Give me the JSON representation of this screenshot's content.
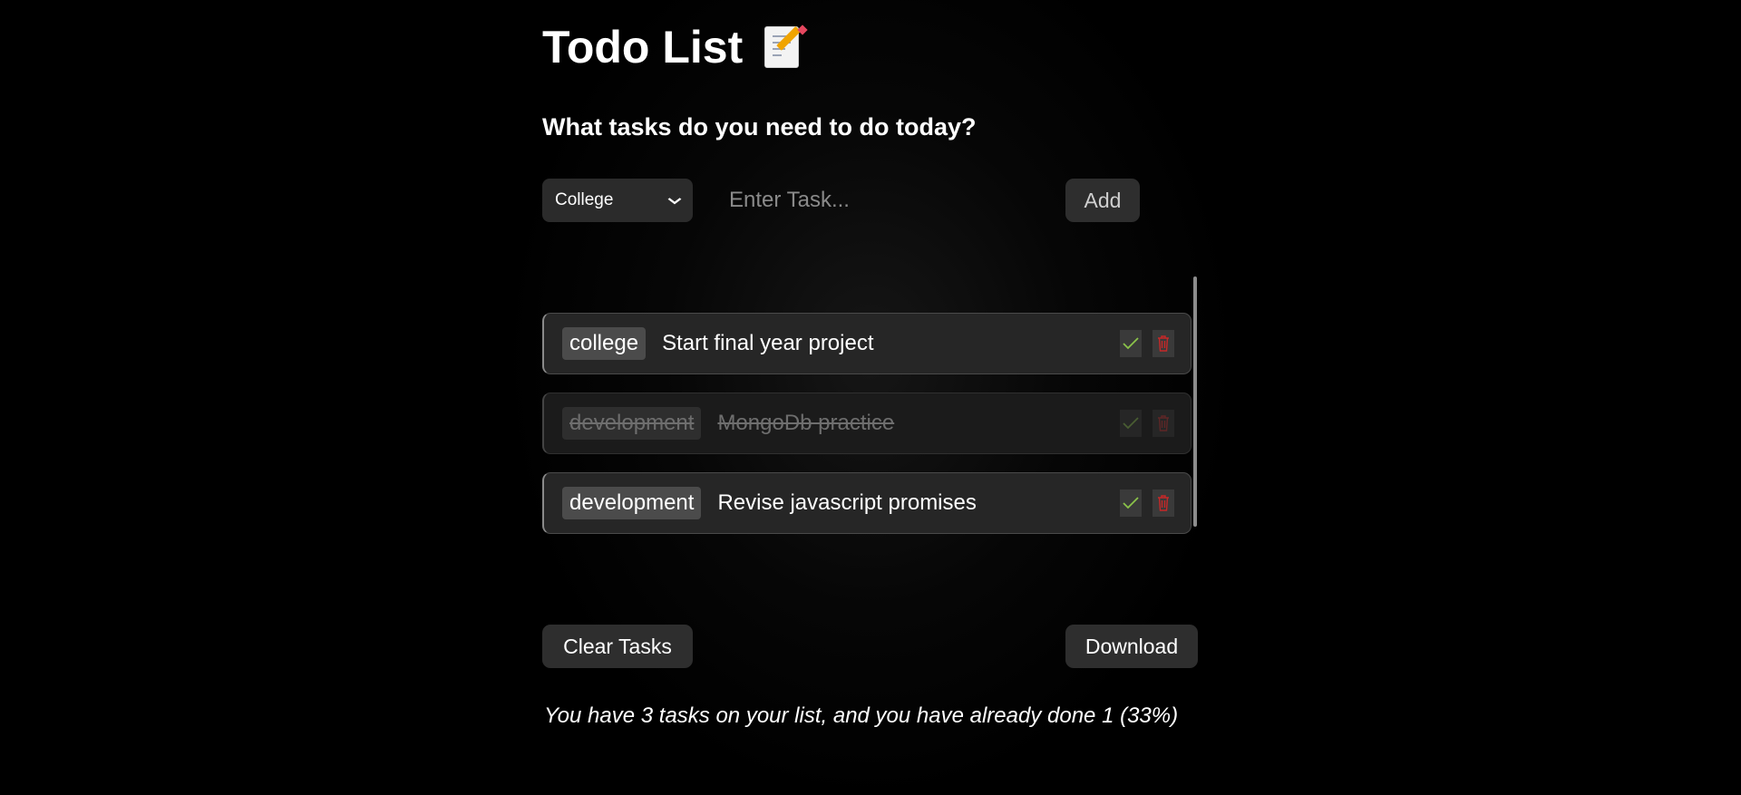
{
  "app": {
    "title": "Todo List",
    "title_icon": "memo-icon",
    "subtitle": "What tasks do you need to do today?"
  },
  "form": {
    "category_selected": "College",
    "task_placeholder": "Enter Task...",
    "task_value": "",
    "add_label": "Add"
  },
  "tasks": [
    {
      "category": "college",
      "text": "Start final year project",
      "done": false
    },
    {
      "category": "development",
      "text": "MongoDb practice",
      "done": true
    },
    {
      "category": "development",
      "text": "Revise javascript promises",
      "done": false
    }
  ],
  "actions": {
    "complete_icon": "check-icon",
    "delete_icon": "trash-icon",
    "check_color": "#8bc34a",
    "delete_color": "#c62828"
  },
  "footer": {
    "clear_label": "Clear Tasks",
    "download_label": "Download",
    "status": "You have 3 tasks on your list, and you have already done 1 (33%)"
  }
}
